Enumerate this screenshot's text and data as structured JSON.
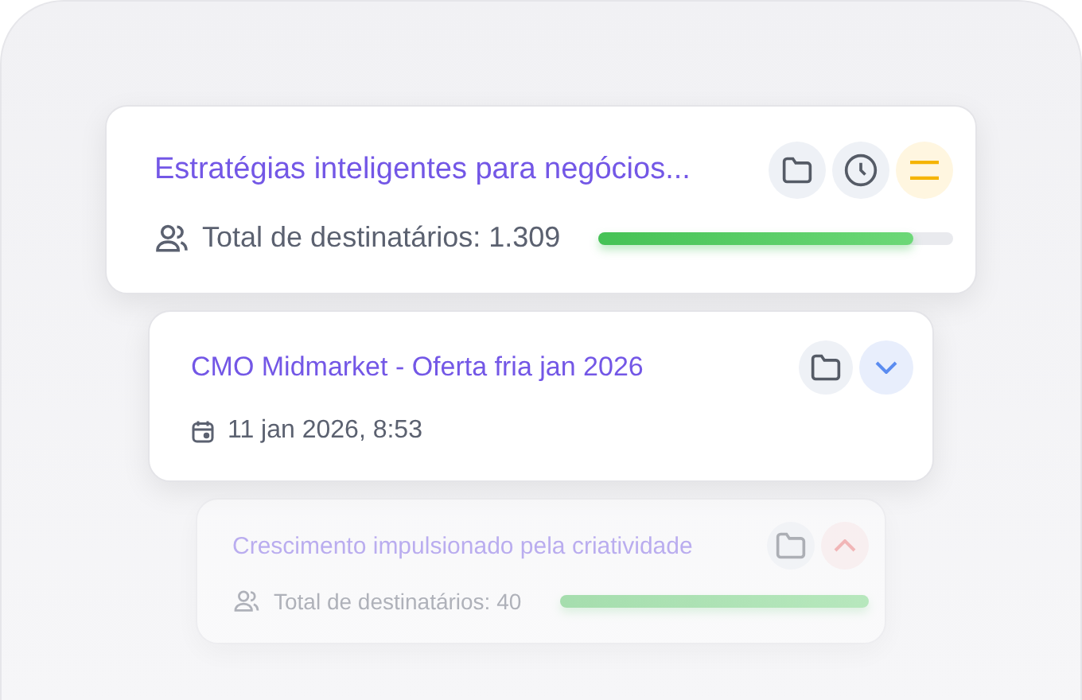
{
  "cards": [
    {
      "title": "Estratégias inteligentes para negócios...",
      "faded": false,
      "actions": [
        {
          "kind": "folder"
        },
        {
          "kind": "clock"
        },
        {
          "kind": "menu"
        }
      ],
      "meta": {
        "kind": "recipients",
        "text": "Total de destinatários: 1.309",
        "level": 0.89
      }
    },
    {
      "title": "CMO Midmarket - Oferta fria jan 2026",
      "faded": false,
      "actions": [
        {
          "kind": "folder"
        },
        {
          "kind": "chevron-down"
        }
      ],
      "meta": {
        "kind": "date",
        "text": "11 jan 2026, 8:53"
      }
    },
    {
      "title": "Crescimento impulsionado pela criatividade",
      "faded": true,
      "actions": [
        {
          "kind": "folder"
        },
        {
          "kind": "chevron-up"
        }
      ],
      "meta": {
        "kind": "recipients",
        "text": "Total de destinatários: 40",
        "level": 1
      }
    }
  ]
}
